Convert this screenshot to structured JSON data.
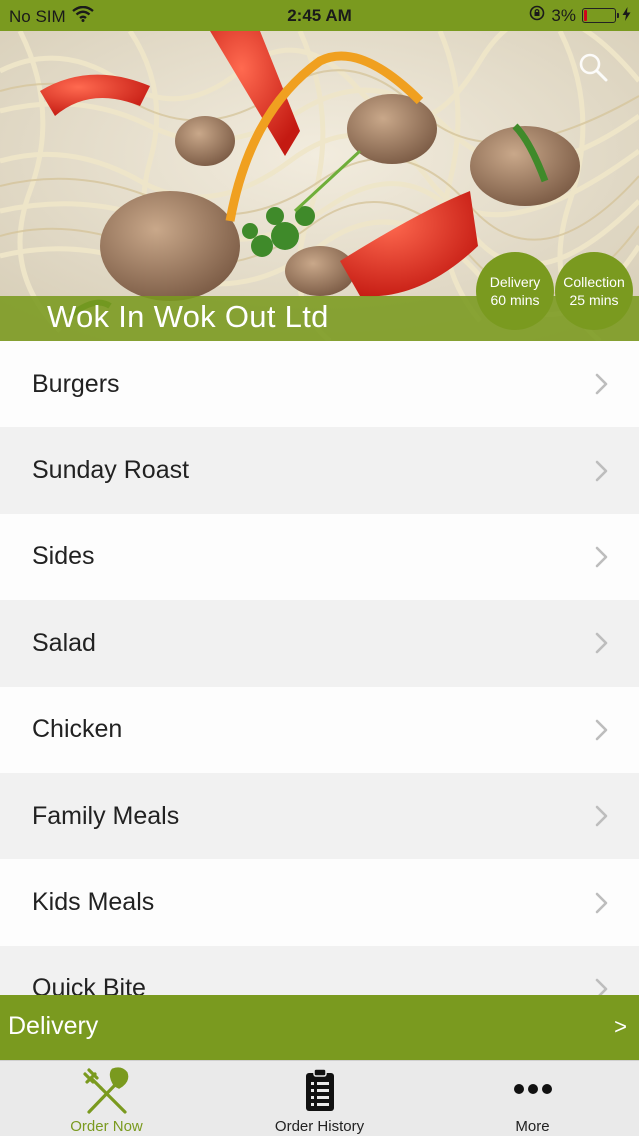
{
  "status_bar": {
    "carrier": "No SIM",
    "time": "2:45 AM",
    "battery": "3%",
    "battery_level": 0.03
  },
  "hero": {
    "restaurant_name": "Wok In Wok Out Ltd",
    "delivery_badge": {
      "title": "Delivery",
      "time": "60 mins"
    },
    "collection_badge": {
      "title": "Collection",
      "time": "25 mins"
    }
  },
  "menu": {
    "categories": [
      {
        "label": "Burgers"
      },
      {
        "label": "Sunday Roast"
      },
      {
        "label": "Sides"
      },
      {
        "label": "Salad"
      },
      {
        "label": "Chicken"
      },
      {
        "label": "Family Meals"
      },
      {
        "label": "Kids Meals"
      },
      {
        "label": "Quick Bite"
      }
    ]
  },
  "delivery_bar": {
    "label": "Delivery",
    "arrow": ">"
  },
  "tab_bar": {
    "tabs": [
      {
        "label": "Order Now",
        "icon": "fork-knife-icon"
      },
      {
        "label": "Order History",
        "icon": "clipboard-list-icon"
      },
      {
        "label": "More",
        "icon": "more-dots-icon"
      }
    ]
  },
  "colors": {
    "accent": "#7a9a1f",
    "battery_low": "#d0021b"
  }
}
